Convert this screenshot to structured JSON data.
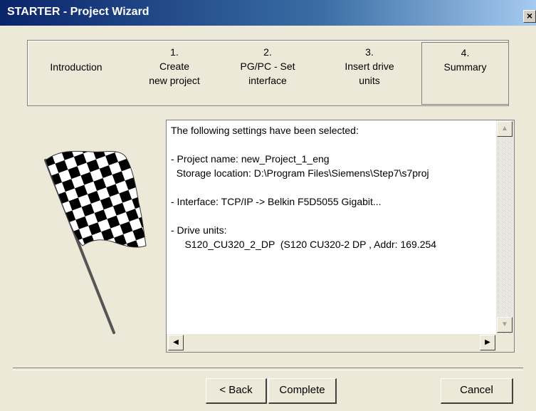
{
  "window": {
    "title": "STARTER - Project Wizard",
    "close_label": "×"
  },
  "steps": {
    "intro": "Introduction",
    "s1": {
      "num": "1.",
      "line1": "Create",
      "line2": "new project"
    },
    "s2": {
      "num": "2.",
      "line1": "PG/PC - Set",
      "line2": "interface"
    },
    "s3": {
      "num": "3.",
      "line1": "Insert drive",
      "line2": "units"
    },
    "s4": {
      "num": "4.",
      "line1": "Summary"
    }
  },
  "summary": {
    "text": "The following settings have been selected:\n\n- Project name: new_Project_1_eng\n  Storage location: D:\\Program Files\\Siemens\\Step7\\s7proj\n\n- Interface: TCP/IP -> Belkin F5D5055 Gigabit...\n\n- Drive units:\n     S120_CU320_2_DP  (S120 CU320-2 DP , Addr: 169.254"
  },
  "scroll_icons": {
    "up": "▲",
    "down": "▼",
    "left": "◀",
    "right": "▶"
  },
  "buttons": {
    "back": "< Back",
    "complete": "Complete",
    "cancel": "Cancel"
  }
}
